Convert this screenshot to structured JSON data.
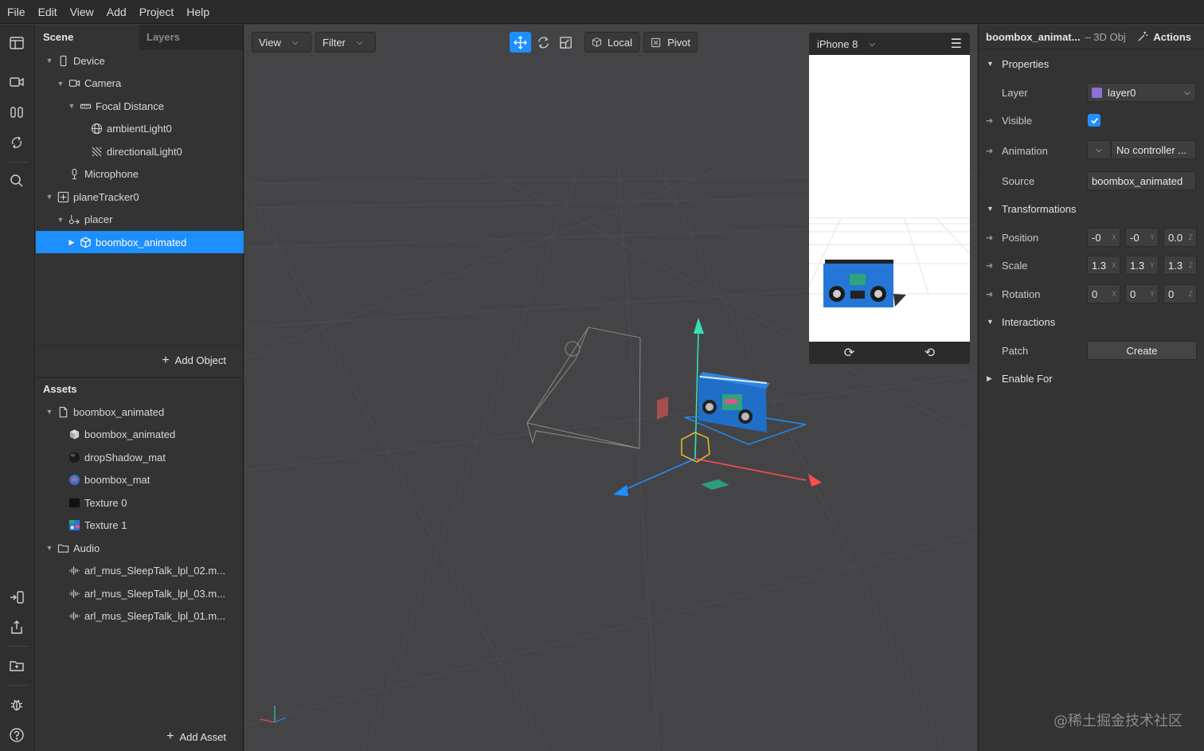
{
  "menu": [
    "File",
    "Edit",
    "View",
    "Add",
    "Project",
    "Help"
  ],
  "scene": {
    "tabs": [
      "Scene",
      "Layers"
    ],
    "items": [
      {
        "label": "Device",
        "depth": 0,
        "caret": "down",
        "icon": "device"
      },
      {
        "label": "Camera",
        "depth": 1,
        "caret": "down",
        "icon": "camera"
      },
      {
        "label": "Focal Distance",
        "depth": 2,
        "caret": "down",
        "icon": "focal"
      },
      {
        "label": "ambientLight0",
        "depth": 3,
        "caret": "",
        "icon": "globe"
      },
      {
        "label": "directionalLight0",
        "depth": 3,
        "caret": "",
        "icon": "dirlight"
      },
      {
        "label": "Microphone",
        "depth": 1,
        "caret": "",
        "icon": "mic"
      },
      {
        "label": "planeTracker0",
        "depth": 0,
        "caret": "down",
        "icon": "tracker"
      },
      {
        "label": "placer",
        "depth": 1,
        "caret": "down",
        "icon": "placer"
      },
      {
        "label": "boombox_animated",
        "depth": 2,
        "caret": "right",
        "icon": "cube",
        "selected": true
      }
    ],
    "add_label": "Add Object"
  },
  "assets": {
    "title": "Assets",
    "items": [
      {
        "label": "boombox_animated",
        "depth": 0,
        "caret": "down",
        "icon": "file"
      },
      {
        "label": "boombox_animated",
        "depth": 1,
        "caret": "",
        "icon": "cube-solid"
      },
      {
        "label": "dropShadow_mat",
        "depth": 1,
        "caret": "",
        "icon": "sphere-dark"
      },
      {
        "label": "boombox_mat",
        "depth": 1,
        "caret": "",
        "icon": "sphere-blue"
      },
      {
        "label": "Texture 0",
        "depth": 1,
        "caret": "",
        "icon": "tex-dark"
      },
      {
        "label": "Texture 1",
        "depth": 1,
        "caret": "",
        "icon": "tex-color"
      },
      {
        "label": "Audio",
        "depth": 0,
        "caret": "down",
        "icon": "folder"
      },
      {
        "label": "arl_mus_SleepTalk_lpl_02.m...",
        "depth": 1,
        "caret": "",
        "icon": "audio"
      },
      {
        "label": "arl_mus_SleepTalk_lpl_03.m...",
        "depth": 1,
        "caret": "",
        "icon": "audio"
      },
      {
        "label": "arl_mus_SleepTalk_lpl_01.m...",
        "depth": 1,
        "caret": "",
        "icon": "audio"
      }
    ],
    "add_label": "Add Asset"
  },
  "viewport": {
    "view_label": "View",
    "filter_label": "Filter",
    "local_label": "Local",
    "pivot_label": "Pivot",
    "device_label": "iPhone 8"
  },
  "properties": {
    "object_name": "boombox_animat...",
    "object_type": "– 3D Obj",
    "actions_label": "Actions",
    "sections": {
      "properties": "Properties",
      "transformations": "Transformations",
      "interactions": "Interactions",
      "enable_for": "Enable For"
    },
    "layer": {
      "label": "Layer",
      "value": "layer0",
      "color": "#8f6fd6"
    },
    "visible": {
      "label": "Visible",
      "checked": true
    },
    "animation": {
      "label": "Animation",
      "value": "No controller ..."
    },
    "source": {
      "label": "Source",
      "value": "boombox_animated"
    },
    "position": {
      "label": "Position",
      "x": "-0",
      "y": "-0",
      "z": "0.0"
    },
    "scale": {
      "label": "Scale",
      "x": "1.3",
      "y": "1.3",
      "z": "1.3"
    },
    "rotation": {
      "label": "Rotation",
      "x": "0",
      "y": "0",
      "z": "0"
    },
    "axes": {
      "x": "X",
      "y": "Y",
      "z": "Z"
    },
    "patch": {
      "label": "Patch",
      "button": "Create"
    }
  },
  "watermark": "@稀土掘金技术社区",
  "colors": {
    "accent": "#1e8fff",
    "x_axis": "#ff4d4d",
    "y_axis": "#35e0b8",
    "z_axis": "#1e8fff"
  }
}
